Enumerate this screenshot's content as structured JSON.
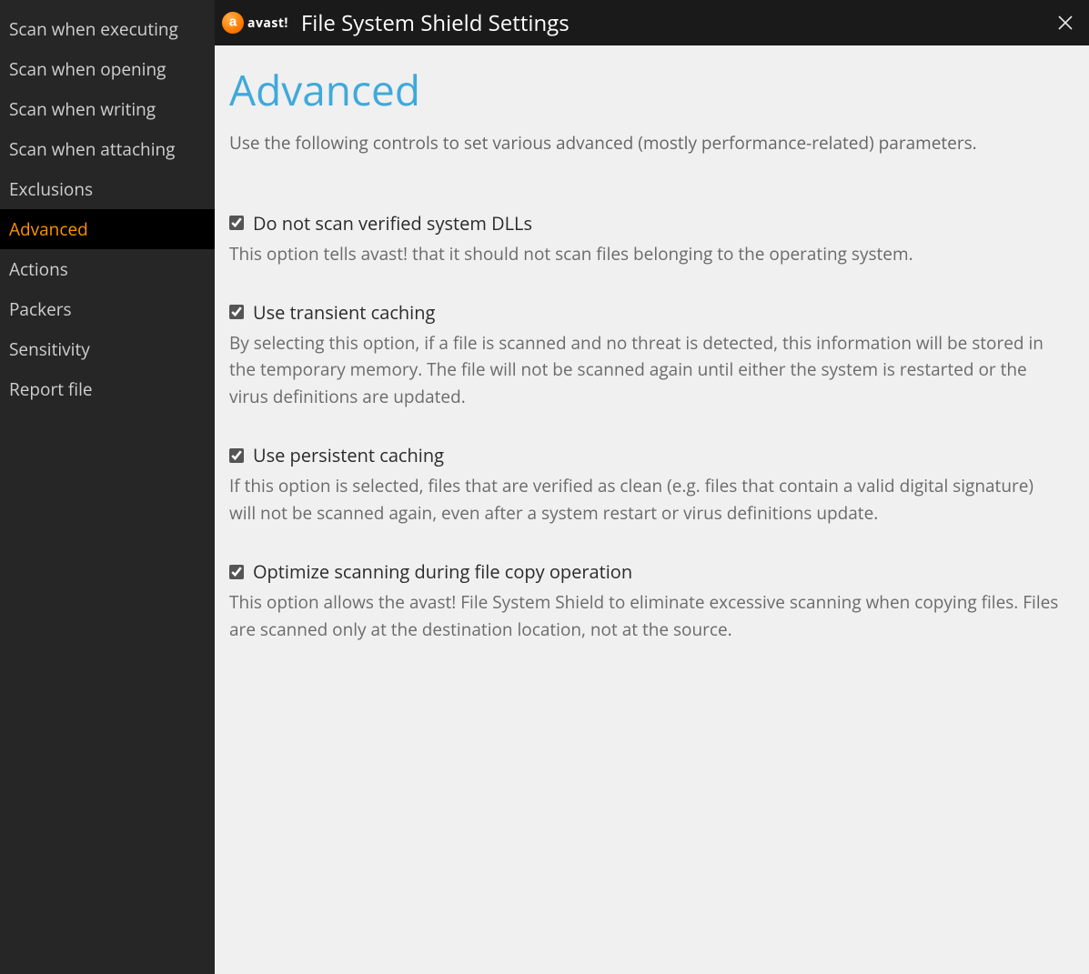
{
  "brand": {
    "name": "avast!"
  },
  "titlebar": {
    "title": "File System Shield Settings"
  },
  "sidebar": {
    "items": [
      {
        "label": "Scan when executing",
        "active": false
      },
      {
        "label": "Scan when opening",
        "active": false
      },
      {
        "label": "Scan when writing",
        "active": false
      },
      {
        "label": "Scan when attaching",
        "active": false
      },
      {
        "label": "Exclusions",
        "active": false
      },
      {
        "label": "Advanced",
        "active": true
      },
      {
        "label": "Actions",
        "active": false
      },
      {
        "label": "Packers",
        "active": false
      },
      {
        "label": "Sensitivity",
        "active": false
      },
      {
        "label": "Report file",
        "active": false
      }
    ]
  },
  "page": {
    "heading": "Advanced",
    "intro": "Use the following controls to set various advanced (mostly performance-related) parameters.",
    "options": [
      {
        "label": "Do not scan verified system DLLs",
        "checked": true,
        "desc": "This option tells avast! that it should not scan files belonging to the operating system."
      },
      {
        "label": "Use transient caching",
        "checked": true,
        "desc": "By selecting this option, if a file is scanned and no threat is detected, this information will be stored in the temporary memory. The file will not be scanned again until either the system is restarted or the virus definitions are updated."
      },
      {
        "label": "Use persistent caching",
        "checked": true,
        "desc": "If this option is selected, files that are verified as clean (e.g. files that contain a valid digital signature) will not be scanned again, even after a system restart or virus definitions update."
      },
      {
        "label": "Optimize scanning during file copy operation",
        "checked": true,
        "desc": "This option allows the avast! File System Shield to eliminate excessive scanning when copying files. Files are scanned only at the destination location, not at the source."
      }
    ]
  }
}
